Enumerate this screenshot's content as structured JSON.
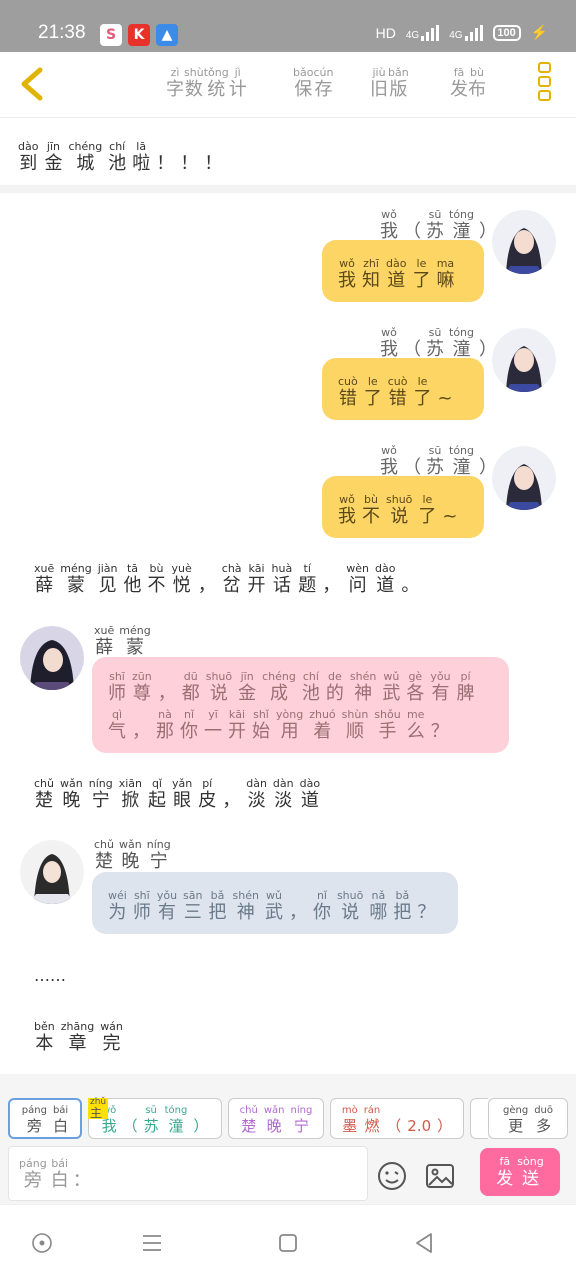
{
  "status_bar": {
    "time": "21:38",
    "network": "HD",
    "signal_1": "4G",
    "signal_2": "4G",
    "battery": "100",
    "app_icons": [
      "soul-icon",
      "kuaishou-icon",
      "cloud-icon"
    ]
  },
  "header": {
    "nav": [
      {
        "id": "word-count",
        "chars": [
          {
            "py": "zì",
            "hz": "字"
          },
          {
            "py": "shù",
            "hz": "数"
          },
          {
            "py": "tǒng",
            "hz": "统"
          },
          {
            "py": "jì",
            "hz": "计"
          }
        ]
      },
      {
        "id": "save",
        "chars": [
          {
            "py": "bǎo",
            "hz": "保"
          },
          {
            "py": "cún",
            "hz": "存"
          }
        ]
      },
      {
        "id": "old-version",
        "chars": [
          {
            "py": "jiù",
            "hz": "旧"
          },
          {
            "py": "bǎn",
            "hz": "版"
          }
        ]
      },
      {
        "id": "publish",
        "chars": [
          {
            "py": "fā",
            "hz": "发"
          },
          {
            "py": "bù",
            "hz": "布"
          }
        ]
      }
    ]
  },
  "story": {
    "intro": [
      {
        "py": "dào",
        "hz": "到"
      },
      {
        "py": "jīn",
        "hz": "金"
      },
      {
        "py": "chéng",
        "hz": "城"
      },
      {
        "py": "chí",
        "hz": "池"
      },
      {
        "py": "lā",
        "hz": "啦"
      },
      {
        "py": "",
        "hz": "！"
      },
      {
        "py": "",
        "hz": "！"
      },
      {
        "py": "",
        "hz": "！"
      }
    ],
    "self_name": [
      {
        "py": "wǒ",
        "hz": "我"
      },
      {
        "py": "",
        "hz": "（"
      },
      {
        "py": "sū",
        "hz": "苏"
      },
      {
        "py": "tóng",
        "hz": "潼"
      },
      {
        "py": "",
        "hz": "）"
      }
    ],
    "msg1": [
      {
        "py": "wǒ",
        "hz": "我"
      },
      {
        "py": "zhī",
        "hz": "知"
      },
      {
        "py": "dào",
        "hz": "道"
      },
      {
        "py": "le",
        "hz": "了"
      },
      {
        "py": "ma",
        "hz": "嘛"
      }
    ],
    "msg2": [
      {
        "py": "cuò",
        "hz": "错"
      },
      {
        "py": "le",
        "hz": "了"
      },
      {
        "py": "cuò",
        "hz": "错"
      },
      {
        "py": "le",
        "hz": "了"
      },
      {
        "py": "",
        "hz": "~"
      }
    ],
    "msg3": [
      {
        "py": "wǒ",
        "hz": "我"
      },
      {
        "py": "bù",
        "hz": "不"
      },
      {
        "py": "shuō",
        "hz": "说"
      },
      {
        "py": "le",
        "hz": "了"
      },
      {
        "py": "",
        "hz": "~"
      }
    ],
    "narr1": [
      {
        "py": "xuē",
        "hz": "薛"
      },
      {
        "py": "méng",
        "hz": "蒙"
      },
      {
        "py": "jiàn",
        "hz": "见"
      },
      {
        "py": "tā",
        "hz": "他"
      },
      {
        "py": "bù",
        "hz": "不"
      },
      {
        "py": "yuè",
        "hz": "悦"
      },
      {
        "py": "",
        "hz": "，"
      },
      {
        "py": "chà",
        "hz": "岔"
      },
      {
        "py": "kāi",
        "hz": "开"
      },
      {
        "py": "huà",
        "hz": "话"
      },
      {
        "py": "tí",
        "hz": "题"
      },
      {
        "py": "",
        "hz": "，"
      },
      {
        "py": "wèn",
        "hz": "问"
      },
      {
        "py": "dào",
        "hz": "道"
      },
      {
        "py": "",
        "hz": "。"
      }
    ],
    "xue_name": [
      {
        "py": "xuē",
        "hz": "薛"
      },
      {
        "py": "méng",
        "hz": "蒙"
      }
    ],
    "xue_msg": [
      {
        "py": "shī",
        "hz": "师"
      },
      {
        "py": "zūn",
        "hz": "尊"
      },
      {
        "py": "",
        "hz": "，"
      },
      {
        "py": "dū",
        "hz": "都"
      },
      {
        "py": "shuō",
        "hz": "说"
      },
      {
        "py": "jīn",
        "hz": "金"
      },
      {
        "py": "chéng",
        "hz": "成"
      },
      {
        "py": "chí",
        "hz": "池"
      },
      {
        "py": "de",
        "hz": "的"
      },
      {
        "py": "shén",
        "hz": "神"
      },
      {
        "py": "wǔ",
        "hz": "武"
      },
      {
        "py": "gè",
        "hz": "各"
      },
      {
        "py": "yǒu",
        "hz": "有"
      },
      {
        "py": "pí",
        "hz": "脾"
      },
      {
        "py": "qì",
        "hz": "气"
      },
      {
        "py": "",
        "hz": "，"
      },
      {
        "py": "nà",
        "hz": "那"
      },
      {
        "py": "nǐ",
        "hz": "你"
      },
      {
        "py": "yī",
        "hz": "一"
      },
      {
        "py": "kāi",
        "hz": "开"
      },
      {
        "py": "shǐ",
        "hz": "始"
      },
      {
        "py": "yòng",
        "hz": "用"
      },
      {
        "py": "zhuó",
        "hz": "着"
      },
      {
        "py": "shùn",
        "hz": "顺"
      },
      {
        "py": "shǒu",
        "hz": "手"
      },
      {
        "py": "me",
        "hz": "么"
      },
      {
        "py": "",
        "hz": "？"
      }
    ],
    "narr2": [
      {
        "py": "chǔ",
        "hz": "楚"
      },
      {
        "py": "wǎn",
        "hz": "晚"
      },
      {
        "py": "níng",
        "hz": "宁"
      },
      {
        "py": "xiān",
        "hz": "掀"
      },
      {
        "py": "qǐ",
        "hz": "起"
      },
      {
        "py": "yǎn",
        "hz": "眼"
      },
      {
        "py": "pí",
        "hz": "皮"
      },
      {
        "py": "",
        "hz": "，"
      },
      {
        "py": "dàn",
        "hz": "淡"
      },
      {
        "py": "dàn",
        "hz": "淡"
      },
      {
        "py": "dào",
        "hz": "道"
      }
    ],
    "chu_name": [
      {
        "py": "chǔ",
        "hz": "楚"
      },
      {
        "py": "wǎn",
        "hz": "晚"
      },
      {
        "py": "níng",
        "hz": "宁"
      }
    ],
    "chu_msg": [
      {
        "py": "wéi",
        "hz": "为"
      },
      {
        "py": "shī",
        "hz": "师"
      },
      {
        "py": "yǒu",
        "hz": "有"
      },
      {
        "py": "sān",
        "hz": "三"
      },
      {
        "py": "bǎ",
        "hz": "把"
      },
      {
        "py": "shén",
        "hz": "神"
      },
      {
        "py": "wǔ",
        "hz": "武"
      },
      {
        "py": "",
        "hz": "，"
      },
      {
        "py": "nǐ",
        "hz": "你"
      },
      {
        "py": "shuō",
        "hz": "说"
      },
      {
        "py": "nǎ",
        "hz": "哪"
      },
      {
        "py": "bǎ",
        "hz": "把"
      },
      {
        "py": "",
        "hz": "？"
      }
    ],
    "ellipsis": "……",
    "ending": [
      {
        "py": "běn",
        "hz": "本"
      },
      {
        "py": "zhāng",
        "hz": "章"
      },
      {
        "py": "wán",
        "hz": "完"
      }
    ]
  },
  "composer": {
    "chips": [
      {
        "id": "narrator",
        "chars": [
          {
            "py": "páng",
            "hz": "旁"
          },
          {
            "py": "bái",
            "hz": "白"
          }
        ]
      },
      {
        "id": "self",
        "host_tag": "主",
        "host_py": "zhǔ",
        "chars": [
          {
            "py": "wǒ",
            "hz": "我"
          },
          {
            "py": "",
            "hz": "（"
          },
          {
            "py": "sū",
            "hz": "苏"
          },
          {
            "py": "tóng",
            "hz": "潼"
          },
          {
            "py": "",
            "hz": "）"
          }
        ]
      },
      {
        "id": "chu",
        "chars": [
          {
            "py": "chǔ",
            "hz": "楚"
          },
          {
            "py": "wǎn",
            "hz": "晚"
          },
          {
            "py": "níng",
            "hz": "宁"
          }
        ]
      },
      {
        "id": "moran",
        "chars": [
          {
            "py": "mò",
            "hz": "墨"
          },
          {
            "py": "rán",
            "hz": "燃"
          },
          {
            "py": "",
            "hz": "（"
          },
          {
            "py": "",
            "hz": "2.0"
          },
          {
            "py": "",
            "hz": "）"
          }
        ]
      },
      {
        "id": "more",
        "chars": [
          {
            "py": "gèng",
            "hz": "更"
          },
          {
            "py": "duō",
            "hz": "多"
          }
        ]
      }
    ],
    "input_label": [
      {
        "py": "páng",
        "hz": "旁"
      },
      {
        "py": "bái",
        "hz": "白"
      },
      {
        "py": "",
        "hz": "："
      }
    ],
    "send": [
      {
        "py": "fā",
        "hz": "发"
      },
      {
        "py": "sòng",
        "hz": "送"
      }
    ]
  },
  "colors": {
    "yellow_bubble": "#fdd565",
    "pink_bubble": "#fdd0da",
    "blue_bubble": "#dee4ee",
    "send": "#ff6b9e",
    "accent": "#e0b400"
  }
}
